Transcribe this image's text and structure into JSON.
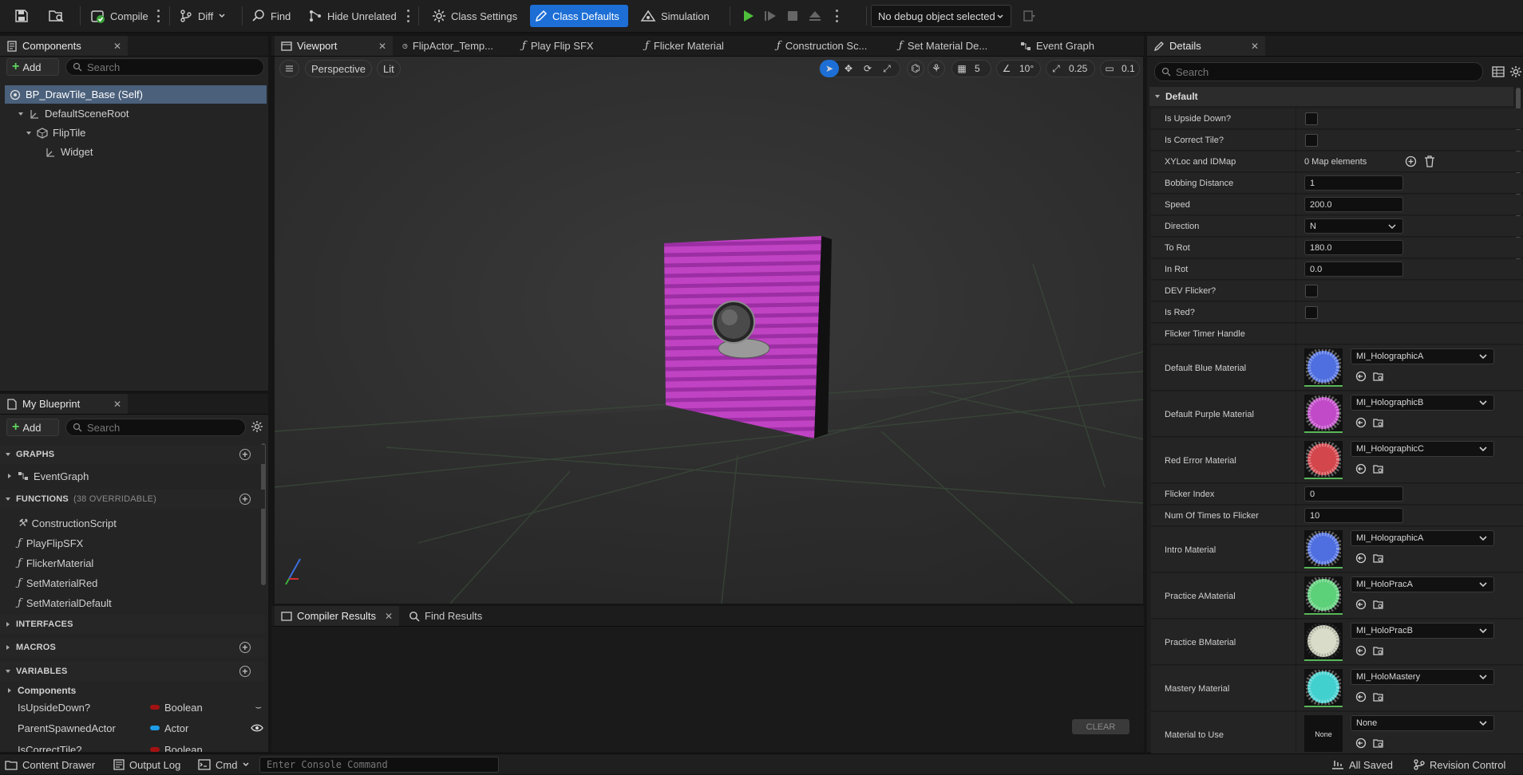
{
  "toolbar": {
    "compile": "Compile",
    "diff": "Diff",
    "find": "Find",
    "hide_unrelated": "Hide Unrelated",
    "class_settings": "Class Settings",
    "class_defaults": "Class Defaults",
    "simulation": "Simulation",
    "debug_object": "No debug object selected"
  },
  "components_panel": {
    "tab": "Components",
    "add": "Add",
    "search_placeholder": "Search",
    "tree": [
      {
        "label": "BP_DrawTile_Base (Self)"
      },
      {
        "label": "DefaultSceneRoot"
      },
      {
        "label": "FlipTile"
      },
      {
        "label": "Widget"
      }
    ]
  },
  "my_blueprint": {
    "tab": "My Blueprint",
    "add": "Add",
    "search_placeholder": "Search",
    "graphs_header": "GRAPHS",
    "graphs": [
      "EventGraph"
    ],
    "functions_header": "FUNCTIONS",
    "functions_sub": "(38 OVERRIDABLE)",
    "functions": [
      "ConstructionScript",
      "PlayFlipSFX",
      "FlickerMaterial",
      "SetMaterialRed",
      "SetMaterialDefault"
    ],
    "interfaces_header": "INTERFACES",
    "macros_header": "MACROS",
    "variables_header": "VARIABLES",
    "variables_group": "Components",
    "variables": [
      {
        "name": "IsUpsideDown?",
        "type": "Boolean",
        "color": "#a31212"
      },
      {
        "name": "ParentSpawnedActor",
        "type": "Actor",
        "color": "#1e9be6"
      },
      {
        "name": "IsCorrectTile?",
        "type": "Boolean",
        "color": "#a31212"
      }
    ]
  },
  "editor_tabs": [
    {
      "label": "Viewport"
    },
    {
      "label": "FlipActor_Temp..."
    },
    {
      "label": "Play Flip SFX"
    },
    {
      "label": "Flicker Material"
    },
    {
      "label": "Construction Sc..."
    },
    {
      "label": "Set Material De..."
    },
    {
      "label": "Event Graph"
    }
  ],
  "viewport": {
    "perspective": "Perspective",
    "lit": "Lit",
    "grid_snap": "5",
    "rot_snap": "10°",
    "scale_snap": "0.25",
    "cam_speed": "0.1",
    "tile_color": "#c043c4"
  },
  "bottom_panel": {
    "tab_compiler": "Compiler Results",
    "tab_find": "Find Results",
    "clear": "CLEAR"
  },
  "details": {
    "tab": "Details",
    "search_placeholder": "Search",
    "section": "Default",
    "props": {
      "is_upside_down": "Is Upside Down?",
      "is_correct_tile": "Is Correct Tile?",
      "xyloc_label": "XYLoc and IDMap",
      "xyloc_value": "0 Map elements",
      "bobbing_label": "Bobbing Distance",
      "bobbing_value": "1",
      "speed_label": "Speed",
      "speed_value": "200.0",
      "direction_label": "Direction",
      "direction_value": "N",
      "to_rot_label": "To Rot",
      "to_rot_value": "180.0",
      "in_rot_label": "In Rot",
      "in_rot_value": "0.0",
      "dev_flicker": "DEV Flicker?",
      "is_red": "Is Red?",
      "flicker_timer": "Flicker Timer Handle",
      "flicker_index_label": "Flicker Index",
      "flicker_index_value": "0",
      "num_flicker_label": "Num Of Times to Flicker",
      "num_flicker_value": "10"
    },
    "materials": [
      {
        "label": "Default Blue Material",
        "value": "MI_HolographicA",
        "color": "#4f6fe0"
      },
      {
        "label": "Default Purple Material",
        "value": "MI_HolographicB",
        "color": "#c14ac8"
      },
      {
        "label": "Red Error Material",
        "value": "MI_HolographicC",
        "color": "#d2464c"
      },
      {
        "label": "Intro Material",
        "value": "MI_HolographicA",
        "color": "#4f6fe0"
      },
      {
        "label": "Practice AMaterial",
        "value": "MI_HoloPracA",
        "color": "#5dd07a"
      },
      {
        "label": "Practice BMaterial",
        "value": "MI_HoloPracB",
        "color": "#d9dcc8"
      },
      {
        "label": "Mastery Material",
        "value": "MI_HoloMastery",
        "color": "#42d0cf"
      }
    ],
    "material_to_use_label": "Material to Use",
    "material_to_use_value": "None",
    "none_thumb": "None"
  },
  "statusbar": {
    "content_drawer": "Content Drawer",
    "output_log": "Output Log",
    "cmd": "Cmd",
    "console_placeholder": "Enter Console Command",
    "all_saved": "All Saved",
    "revision_control": "Revision Control"
  }
}
